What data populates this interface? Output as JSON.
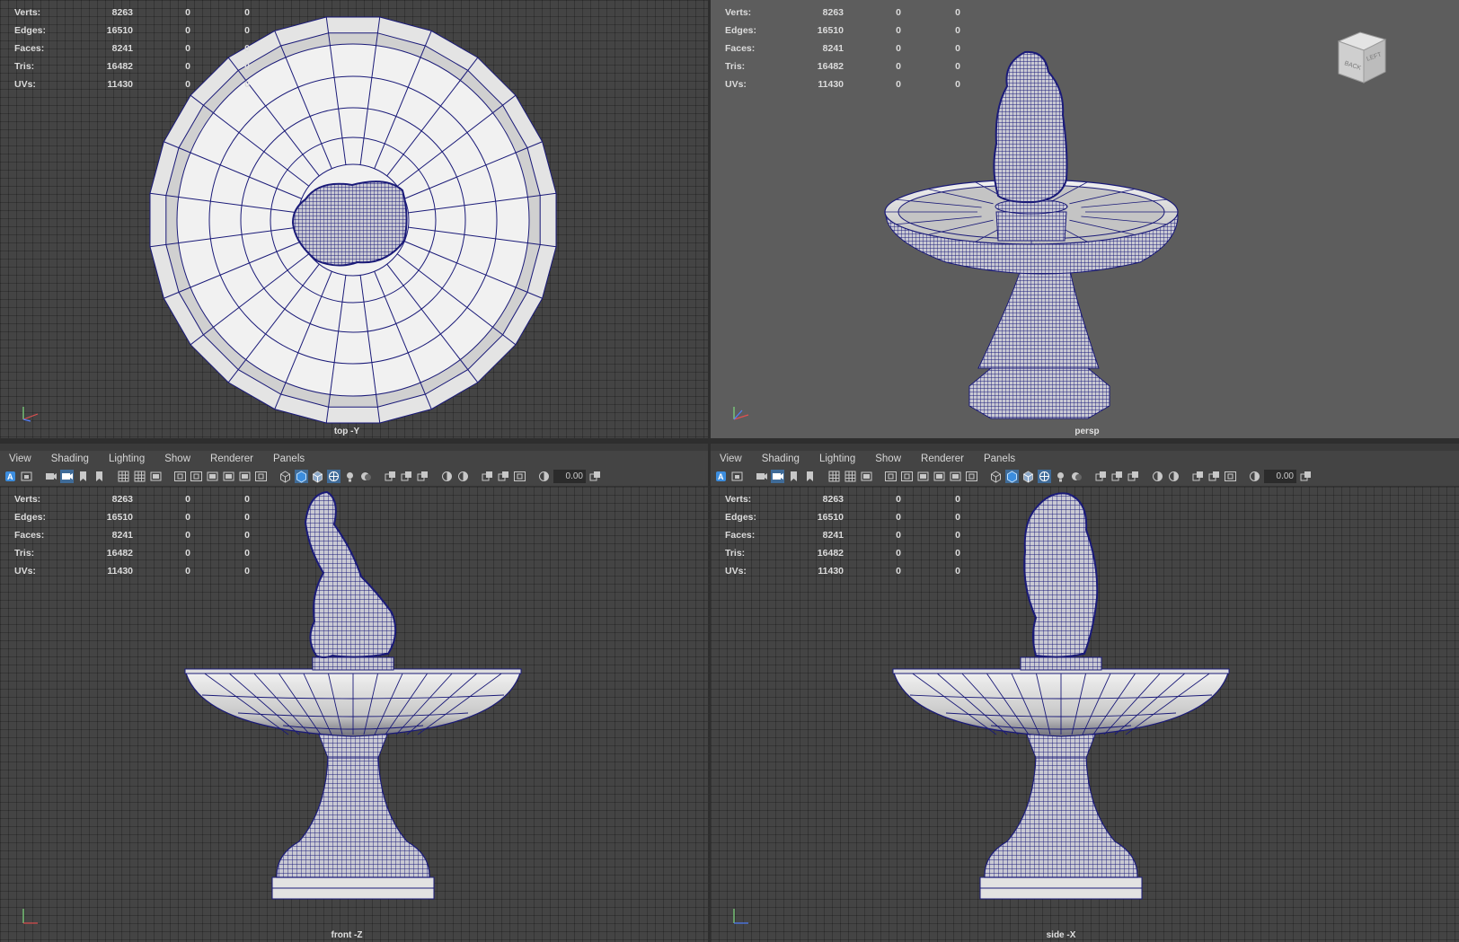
{
  "stats_labels": [
    "Verts:",
    "Edges:",
    "Faces:",
    "Tris:",
    "UVs:"
  ],
  "stats_values": [
    [
      "8263",
      "0",
      "0"
    ],
    [
      "16510",
      "0",
      "0"
    ],
    [
      "8241",
      "0",
      "0"
    ],
    [
      "16482",
      "0",
      "0"
    ],
    [
      "11430",
      "0",
      "0"
    ]
  ],
  "viewports": {
    "top": {
      "camera": "top -Y"
    },
    "persp": {
      "camera": "persp",
      "viewcube": {
        "back": "BACK",
        "left": "LEFT"
      }
    },
    "front": {
      "camera": "front -Z"
    },
    "side": {
      "camera": "side -X"
    }
  },
  "panel_menu": [
    "View",
    "Shading",
    "Lighting",
    "Show",
    "Renderer",
    "Panels"
  ],
  "toolbar": {
    "exposure_value": "0.00"
  },
  "colors": {
    "wire": "#1a1a78",
    "surface": "#d7d7d7",
    "grid_bg": "#444444",
    "persp_bg": "#5d5d5d",
    "highlight": "#3c8dde"
  },
  "icons": [
    "select-camera-icon",
    "lock-camera-icon",
    "bookmark-icon",
    "image-plane-icon",
    "grid-icon",
    "film-gate-icon",
    "resolution-gate-icon",
    "wireframe-icon",
    "smooth-shade-icon",
    "wireframe-on-shaded-icon",
    "xray-icon",
    "lighting-icon",
    "shadows-icon",
    "isolate-icon",
    "exposure-icon"
  ]
}
